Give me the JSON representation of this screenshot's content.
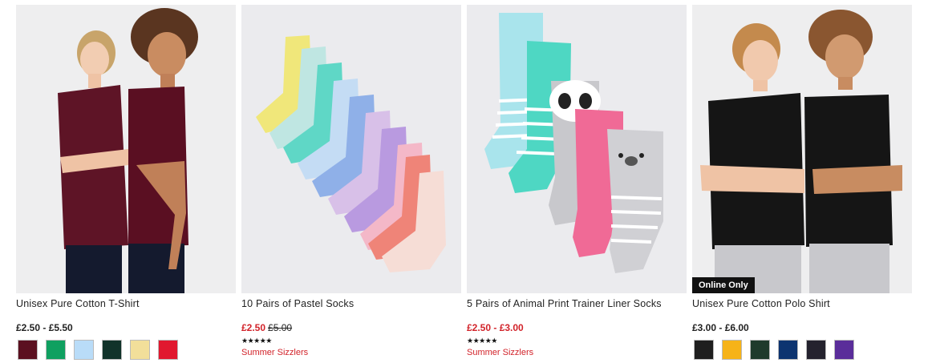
{
  "products": [
    {
      "name": "Unisex Pure Cotton T-Shirt",
      "price": "£2.50 - £5.50",
      "swatches": [
        {
          "name": "maroon",
          "color": "#5b1020"
        },
        {
          "name": "green",
          "color": "#0fa060"
        },
        {
          "name": "light blue",
          "color": "#b9dcf8"
        },
        {
          "name": "bottle green",
          "color": "#11332a"
        },
        {
          "name": "yellow",
          "color": "#f2df9a"
        },
        {
          "name": "red",
          "color": "#e1182f"
        }
      ]
    },
    {
      "name": "10 Pairs of Pastel Socks",
      "price": "£2.50",
      "was_price": "£5.00",
      "rating_stars": "★★★★★",
      "rating_value": 4.5,
      "promo": "Summer Sizzlers"
    },
    {
      "name": "5 Pairs of Animal Print Trainer Liner Socks",
      "price": "£2.50 - £3.00",
      "rating_stars": "★★★★★",
      "rating_value": 5,
      "promo": "Summer Sizzlers"
    },
    {
      "name": "Unisex Pure Cotton Polo Shirt",
      "price": "£3.00 - £6.00",
      "badge": "Online Only",
      "swatches": [
        {
          "name": "black",
          "color": "#1f1f1f"
        },
        {
          "name": "yellow",
          "color": "#f6b318"
        },
        {
          "name": "bottle green",
          "color": "#1f3a2c"
        },
        {
          "name": "navy",
          "color": "#0d3470"
        },
        {
          "name": "dark navy",
          "color": "#24222e"
        },
        {
          "name": "purple",
          "color": "#5a2d9a"
        }
      ]
    }
  ]
}
